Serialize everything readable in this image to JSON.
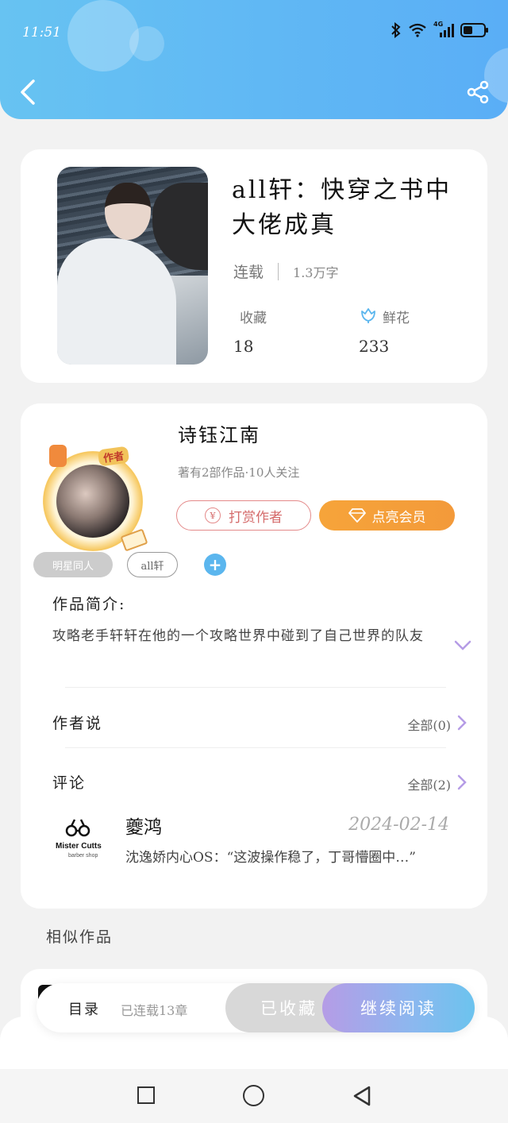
{
  "status_bar": {
    "time": "11:51",
    "network": "4G"
  },
  "book": {
    "title": "all轩：快穿之书中大佬成真",
    "status": "连载",
    "word_count": "1.3万字",
    "favorites_label": "收藏",
    "favorites_value": "18",
    "flowers_label": "鲜花",
    "flowers_value": "233"
  },
  "author": {
    "badge": "作者",
    "name": "诗钰江南",
    "sub": "著有2部作品·10人关注",
    "tip_button": "打赏作者",
    "tip_icon": "¥",
    "vip_button": "点亮会员"
  },
  "tags": [
    "明星同人",
    "all轩"
  ],
  "tag_add": "+",
  "intro": {
    "label": "作品简介:",
    "text": "攻略老手轩轩在他的一个攻略世界中碰到了自己世界的队友"
  },
  "author_says": {
    "label": "作者说",
    "all": "全部(0)"
  },
  "comments": {
    "label": "评论",
    "all": "全部(2)",
    "items": [
      {
        "logo_title": "Mister Cutts",
        "logo_sub": "barber shop",
        "name": "夔鸿",
        "date": "2024-02-14",
        "text": "沈逸娇内心OS：“这波操作稳了，丁哥懵圈中…”"
      }
    ]
  },
  "similar_label": "相似作品",
  "bottom_bar": {
    "toc": "目录",
    "serial": "已连载13章",
    "favorited": "已收藏",
    "continue": "继续阅读"
  },
  "colors": {
    "header_start": "#67c3f2",
    "header_end": "#5aaef6",
    "vip": "#f6a43a",
    "tip": "#e48a8a",
    "accent_purple": "#b59ce6"
  }
}
